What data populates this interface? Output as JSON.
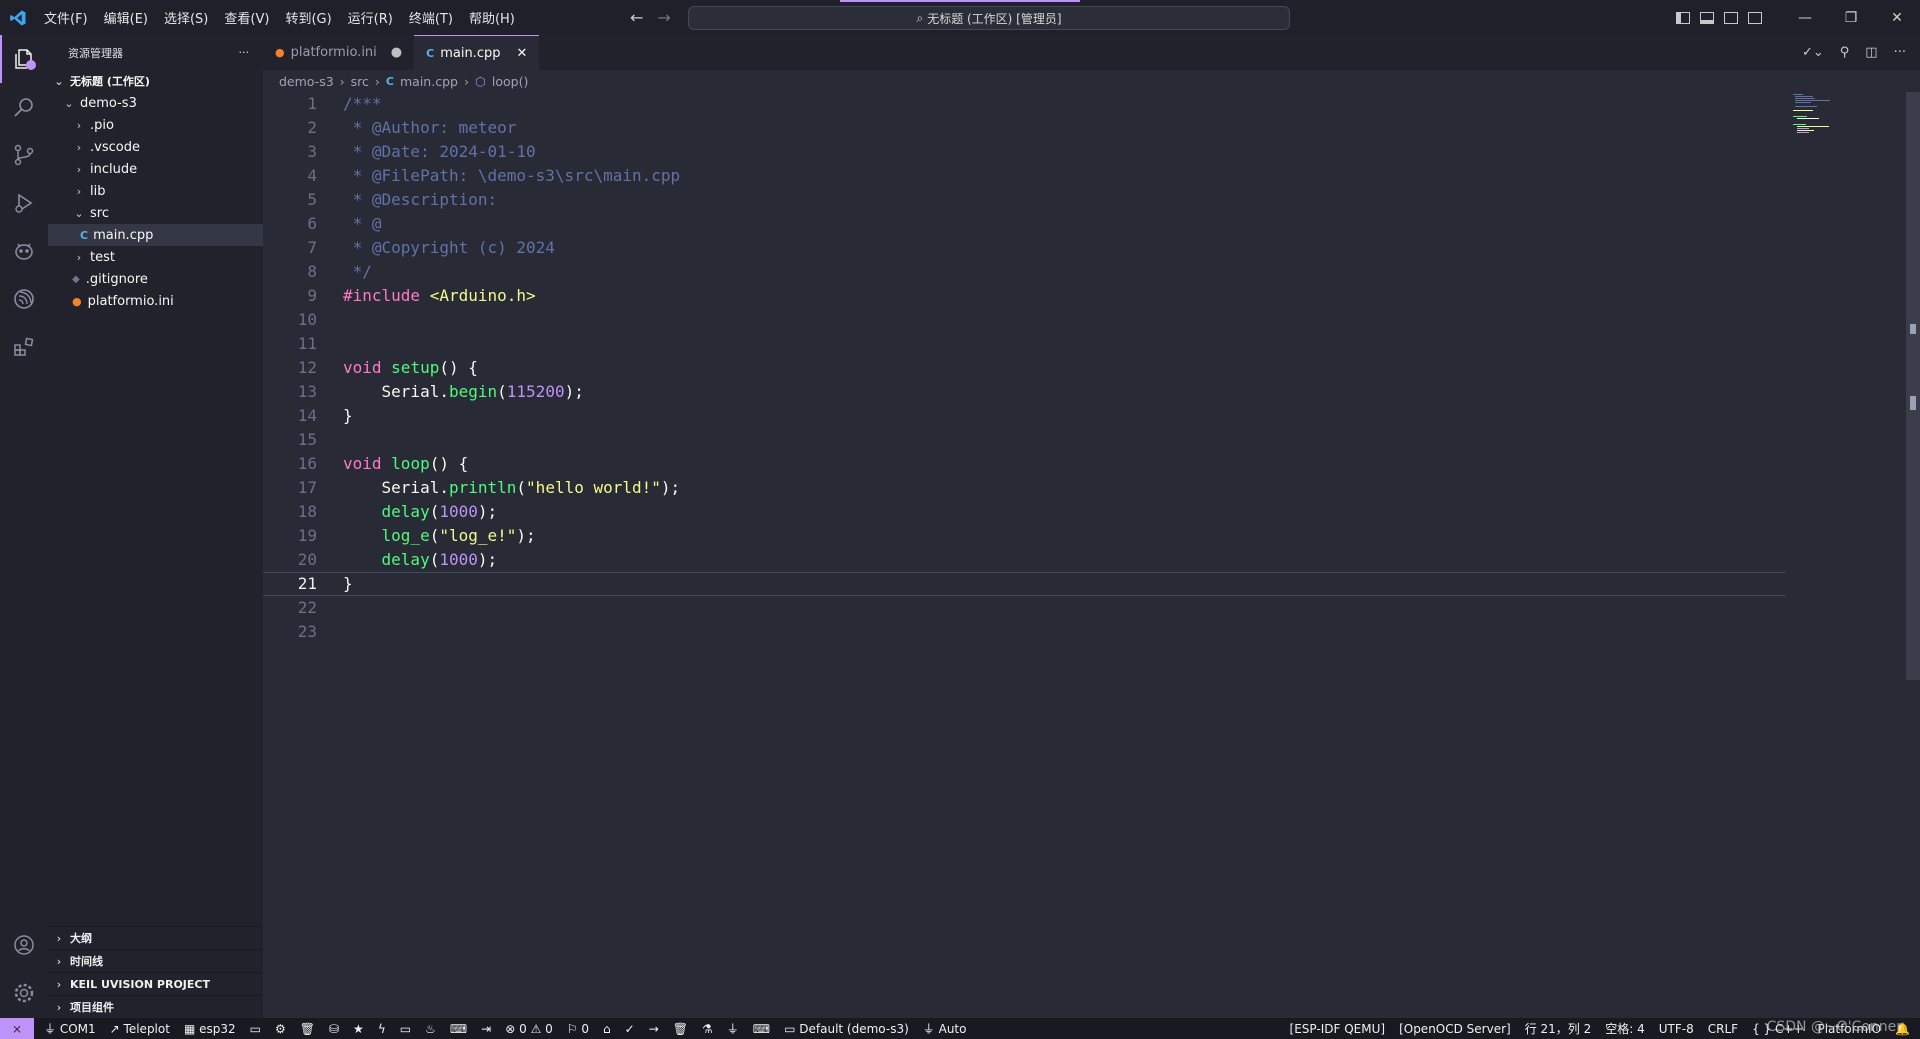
{
  "menu": [
    "文件(F)",
    "编辑(E)",
    "选择(S)",
    "查看(V)",
    "转到(G)",
    "运行(R)",
    "终端(T)",
    "帮助(H)"
  ],
  "command_center": "无标题 (工作区) [管理员]",
  "explorer": {
    "title": "资源管理器",
    "more": "···",
    "workspace": "无标题 (工作区)",
    "project": "demo-s3",
    "items": [
      ".pio",
      ".vscode",
      "include",
      "lib",
      "src",
      "main.cpp",
      "test",
      ".gitignore",
      "platformio.ini"
    ]
  },
  "bottom_sections": [
    "大纲",
    "时间线",
    "KEIL UVISION PROJECT",
    "项目组件"
  ],
  "tabs": [
    {
      "label": "platformio.ini",
      "state": "modified"
    },
    {
      "label": "main.cpp",
      "state": "active"
    }
  ],
  "breadcrumb": [
    "demo-s3",
    "src",
    "main.cpp",
    "loop()"
  ],
  "code": {
    "current_line": 21,
    "line_numbers": [
      "1",
      "2",
      "3",
      "4",
      "5",
      "6",
      "7",
      "8",
      "9",
      "10",
      "11",
      "12",
      "13",
      "14",
      "15",
      "16",
      "17",
      "18",
      "19",
      "20",
      "21",
      "22",
      "23"
    ],
    "lines": [
      "/***",
      " * @Author: meteor",
      " * @Date: 2024-01-10",
      " * @FilePath: \\demo-s3\\src\\main.cpp",
      " * @Description:",
      " * @",
      " * @Copyright (c) 2024",
      " */",
      "#include <Arduino.h>",
      "",
      "",
      "void setup() {",
      "    Serial.begin(115200);",
      "}",
      "",
      "void loop() {",
      "    Serial.println(\"hello world!\");",
      "    delay(1000);",
      "    log_e(\"log_e!\");",
      "    delay(1000);",
      "}",
      "",
      ""
    ]
  },
  "status": {
    "left": [
      "COM1",
      "Teleplot",
      "esp32",
      "0",
      "0",
      "0",
      "Default (demo-s3)",
      "Auto"
    ],
    "right": [
      "[ESP-IDF QEMU]",
      "[OpenOCD Server]",
      "行 21，列 2",
      "空格: 4",
      "UTF-8",
      "CRLF",
      "{ } C++",
      "PlatformIO"
    ]
  },
  "watermark": "CSDN @~O'Conner",
  "colors": {
    "accent": "#bd93f9",
    "background": "#282a36",
    "sidebar": "#21222c"
  }
}
